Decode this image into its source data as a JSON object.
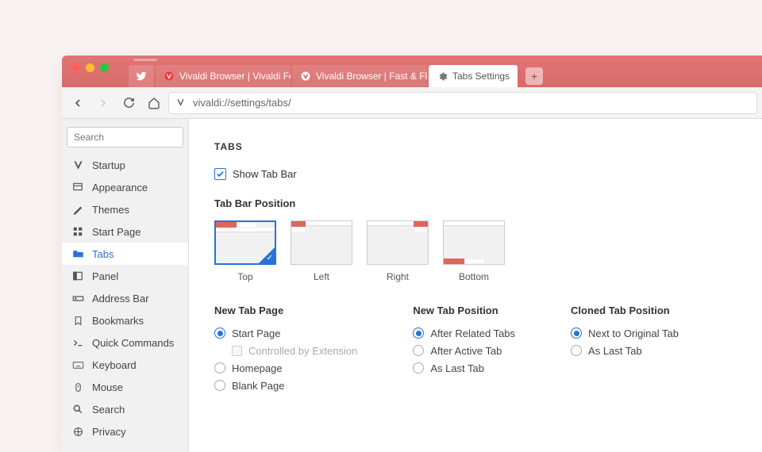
{
  "tabs": {
    "pinned_icon": "twitter",
    "items": [
      {
        "label": "Vivaldi Browser | Vivaldi Forum",
        "active": false
      },
      {
        "label": "Vivaldi Browser | Fast & Flexible",
        "active": false
      },
      {
        "label": "Tabs Settings",
        "active": true
      }
    ]
  },
  "url": "vivaldi://settings/tabs/",
  "search_placeholder": "Search",
  "sidebar": {
    "items": [
      {
        "icon": "startup",
        "label": "Startup"
      },
      {
        "icon": "appearance",
        "label": "Appearance"
      },
      {
        "icon": "themes",
        "label": "Themes"
      },
      {
        "icon": "startpage",
        "label": "Start Page"
      },
      {
        "icon": "tabs",
        "label": "Tabs",
        "active": true
      },
      {
        "icon": "panel",
        "label": "Panel"
      },
      {
        "icon": "addressbar",
        "label": "Address Bar"
      },
      {
        "icon": "bookmarks",
        "label": "Bookmarks"
      },
      {
        "icon": "quickcommands",
        "label": "Quick Commands"
      },
      {
        "icon": "keyboard",
        "label": "Keyboard"
      },
      {
        "icon": "mouse",
        "label": "Mouse"
      },
      {
        "icon": "search",
        "label": "Search"
      },
      {
        "icon": "privacy",
        "label": "Privacy"
      }
    ]
  },
  "content": {
    "heading": "TABS",
    "show_tab_bar": "Show Tab Bar",
    "tab_bar_position_heading": "Tab Bar Position",
    "positions": [
      {
        "label": "Top",
        "selected": true
      },
      {
        "label": "Left"
      },
      {
        "label": "Right"
      },
      {
        "label": "Bottom"
      }
    ],
    "new_tab_page": {
      "heading": "New Tab Page",
      "options": [
        "Start Page",
        "Homepage",
        "Blank Page"
      ],
      "selected": 0,
      "sub": "Controlled by Extension"
    },
    "new_tab_position": {
      "heading": "New Tab Position",
      "options": [
        "After Related Tabs",
        "After Active Tab",
        "As Last Tab"
      ],
      "selected": 0
    },
    "cloned_tab_position": {
      "heading": "Cloned Tab Position",
      "options": [
        "Next to Original Tab",
        "As Last Tab"
      ],
      "selected": 0
    }
  }
}
